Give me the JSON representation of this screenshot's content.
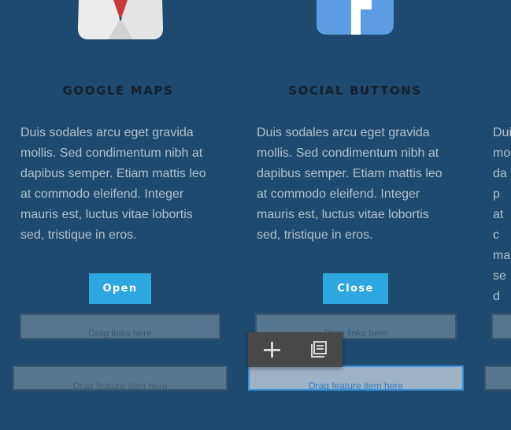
{
  "columns": [
    {
      "title": "GOOGLE MAPS",
      "body": "Duis sodales arcu eget gravida mollis. Sed condimentum nibh at dapibus semper. Etiam mattis leo at commodo eleifend. Integer mauris est, luctus vitae lobortis sed, tristique in eros.",
      "button_label": "Open",
      "links_placeholder": "Drag links here",
      "feature_placeholder": "Drag feature item here"
    },
    {
      "title": "SOCIAL BUTTONS",
      "body": "Duis sodales arcu eget gravida mollis. Sed condimentum nibh at dapibus semper. Etiam mattis leo at commodo eleifend. Integer mauris est, luctus vitae lobortis sed, tristique in eros.",
      "button_label": "Close",
      "links_placeholder": "Drag links here",
      "feature_placeholder": "Drag feature item here"
    },
    {
      "body_fragment": "Dui mo dap at c ma sed"
    }
  ],
  "toolbar": {
    "add_icon": "plus-icon",
    "duplicate_icon": "duplicate-icon"
  },
  "colors": {
    "background": "#1d4a6e",
    "button": "#2ea6df",
    "drop_zone": "#56778f",
    "drop_zone_active": "#9eb2c5",
    "active_border": "#3b8fd6",
    "toolbar": "#484848"
  }
}
